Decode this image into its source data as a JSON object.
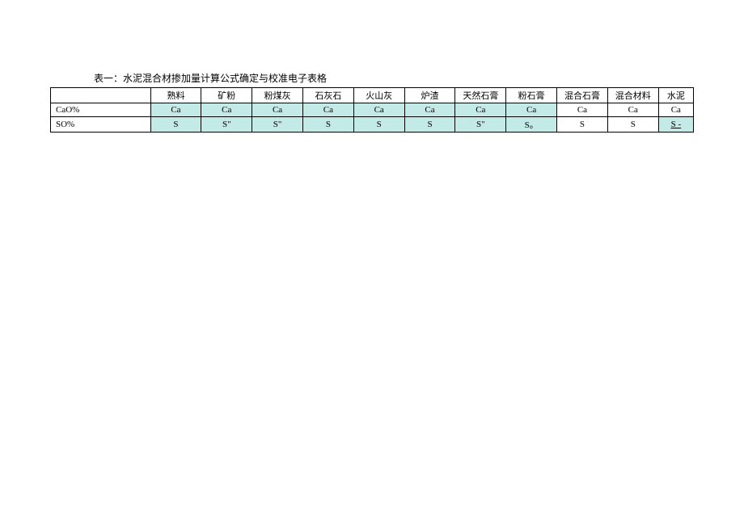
{
  "title": "表一：水泥混合材掺加量计算公式确定与校准电子表格",
  "headers": [
    "熟料",
    "矿粉",
    "粉煤灰",
    "石灰石",
    "火山灰",
    "炉渣",
    "天然石膏",
    "粉石膏",
    "混合石膏",
    "混合材料",
    "水泥"
  ],
  "rows": [
    {
      "label": "CaO%",
      "cells": [
        {
          "v": "Ca",
          "hl": true
        },
        {
          "v": "Ca",
          "hl": true
        },
        {
          "v": "Ca",
          "hl": true
        },
        {
          "v": "Ca",
          "hl": true
        },
        {
          "v": "Ca",
          "hl": true
        },
        {
          "v": "Ca",
          "hl": true
        },
        {
          "v": "Ca",
          "hl": true
        },
        {
          "v": "Ca",
          "hl": true
        },
        {
          "v": "Ca",
          "hl": false
        },
        {
          "v": "Ca",
          "hl": false
        },
        {
          "v": "Ca",
          "hl": false
        }
      ]
    },
    {
      "label": "SO%",
      "cells": [
        {
          "v": "S",
          "hl": true
        },
        {
          "v": "S\"",
          "hl": true
        },
        {
          "v": "S\"",
          "hl": true
        },
        {
          "v": "S",
          "hl": true
        },
        {
          "v": "S",
          "hl": true
        },
        {
          "v": "S",
          "hl": true
        },
        {
          "v": "S\"",
          "hl": true
        },
        {
          "v": "S。",
          "hl": true
        },
        {
          "v": "S",
          "hl": false
        },
        {
          "v": "S",
          "hl": false
        },
        {
          "v": "S -",
          "hl": true,
          "last": true
        }
      ]
    }
  ]
}
